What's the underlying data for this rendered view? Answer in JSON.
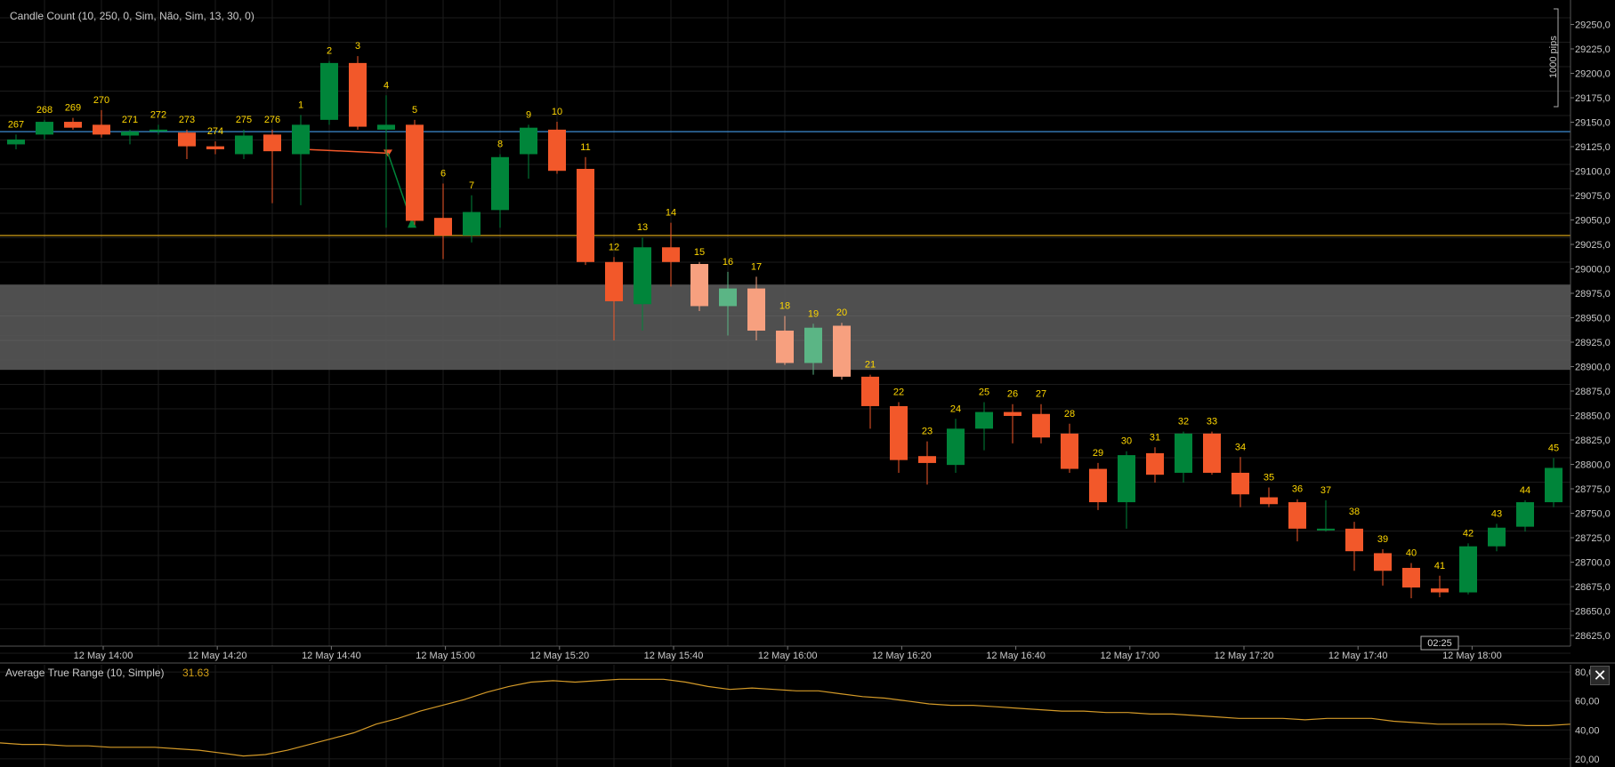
{
  "indicator_label": "Candle Count (10, 250, 0, Sim, Não, Sim, 13, 30, 0)",
  "atr_label": "Average True Range (10, Simple)",
  "atr_value": "31.63",
  "scale_note": "1000 pips",
  "timer": "02:25",
  "close_icon": "close-icon",
  "colors": {
    "background": "#000000",
    "bull": "#00853a",
    "bear": "#f2582a",
    "bull_light": "#5bb585",
    "bear_light": "#f7a07f",
    "count_label": "#ffd700",
    "blue_line": "#3d8bd0",
    "gold_line": "#d4a017",
    "atr_line": "#d49a28",
    "zone": "#585858"
  },
  "chart_data": {
    "type": "candlestick",
    "y_range": [
      28615,
      29265
    ],
    "y_ticks": [
      "29250,0",
      "29225,0",
      "29200,0",
      "29175,0",
      "29150,0",
      "29125,0",
      "29100,0",
      "29075,0",
      "29050,0",
      "29025,0",
      "29000,0",
      "28975,0",
      "28950,0",
      "28925,0",
      "28900,0",
      "28875,0",
      "28850,0",
      "28825,0",
      "28800,0",
      "28775,0",
      "28750,0",
      "28725,0",
      "28700,0",
      "28675,0",
      "28650,0",
      "28625,0"
    ],
    "x_ticks": [
      "12 May 14:00",
      "12 May 14:20",
      "12 May 14:40",
      "12 May 15:00",
      "12 May 15:20",
      "12 May 15:40",
      "12 May 16:00",
      "12 May 16:20",
      "12 May 16:40",
      "12 May 17:00",
      "12 May 17:20",
      "12 May 17:40",
      "12 May 18:00"
    ],
    "candles": [
      {
        "label": "267",
        "o": 29125,
        "h": 29135,
        "l": 29120,
        "c": 29130
      },
      {
        "label": "268",
        "o": 29135,
        "h": 29150,
        "l": 29130,
        "c": 29148
      },
      {
        "label": "269",
        "o": 29148,
        "h": 29152,
        "l": 29140,
        "c": 29142
      },
      {
        "label": "270",
        "o": 29145,
        "h": 29160,
        "l": 29132,
        "c": 29135
      },
      {
        "label": "271",
        "o": 29134,
        "h": 29140,
        "l": 29125,
        "c": 29138
      },
      {
        "label": "272",
        "o": 29140,
        "h": 29145,
        "l": 29135,
        "c": 29140
      },
      {
        "label": "273",
        "o": 29137,
        "h": 29140,
        "l": 29110,
        "c": 29123
      },
      {
        "label": "274",
        "o": 29123,
        "h": 29128,
        "l": 29115,
        "c": 29120
      },
      {
        "label": "275",
        "o": 29115,
        "h": 29140,
        "l": 29110,
        "c": 29134
      },
      {
        "label": "276",
        "o": 29135,
        "h": 29140,
        "l": 29065,
        "c": 29118
      },
      {
        "label": "1",
        "o": 29115,
        "h": 29155,
        "l": 29063,
        "c": 29145
      },
      {
        "label": "2",
        "o": 29150,
        "h": 29210,
        "l": 29145,
        "c": 29208
      },
      {
        "label": "3",
        "o": 29208,
        "h": 29215,
        "l": 29140,
        "c": 29143
      },
      {
        "label": "4",
        "o": 29140,
        "h": 29175,
        "l": 29040,
        "c": 29145
      },
      {
        "label": "5",
        "o": 29145,
        "h": 29150,
        "l": 29043,
        "c": 29047
      },
      {
        "label": "6",
        "o": 29050,
        "h": 29085,
        "l": 29008,
        "c": 29032
      },
      {
        "label": "7",
        "o": 29032,
        "h": 29073,
        "l": 29025,
        "c": 29056
      },
      {
        "label": "8",
        "o": 29058,
        "h": 29115,
        "l": 29040,
        "c": 29112
      },
      {
        "label": "9",
        "o": 29115,
        "h": 29145,
        "l": 29090,
        "c": 29142
      },
      {
        "label": "10",
        "o": 29140,
        "h": 29148,
        "l": 29095,
        "c": 29098
      },
      {
        "label": "11",
        "o": 29100,
        "h": 29112,
        "l": 29002,
        "c": 29005
      },
      {
        "label": "12",
        "o": 29005,
        "h": 29010,
        "l": 28925,
        "c": 28965
      },
      {
        "label": "13",
        "o": 28962,
        "h": 29030,
        "l": 28935,
        "c": 29020
      },
      {
        "label": "14",
        "o": 29020,
        "h": 29045,
        "l": 28980,
        "c": 29005
      },
      {
        "label": "15",
        "o": 29003,
        "h": 29005,
        "l": 28955,
        "c": 28960
      },
      {
        "label": "16",
        "o": 28960,
        "h": 28995,
        "l": 28930,
        "c": 28978
      },
      {
        "label": "17",
        "o": 28978,
        "h": 28990,
        "l": 28925,
        "c": 28935
      },
      {
        "label": "18",
        "o": 28935,
        "h": 28950,
        "l": 28900,
        "c": 28902
      },
      {
        "label": "19",
        "o": 28902,
        "h": 28942,
        "l": 28890,
        "c": 28938
      },
      {
        "label": "20",
        "o": 28940,
        "h": 28943,
        "l": 28885,
        "c": 28888
      },
      {
        "label": "21",
        "o": 28888,
        "h": 28890,
        "l": 28835,
        "c": 28858
      },
      {
        "label": "22",
        "o": 28858,
        "h": 28862,
        "l": 28790,
        "c": 28803
      },
      {
        "label": "23",
        "o": 28807,
        "h": 28822,
        "l": 28778,
        "c": 28800
      },
      {
        "label": "24",
        "o": 28798,
        "h": 28845,
        "l": 28790,
        "c": 28835
      },
      {
        "label": "25",
        "o": 28835,
        "h": 28862,
        "l": 28813,
        "c": 28852
      },
      {
        "label": "26",
        "o": 28852,
        "h": 28860,
        "l": 28820,
        "c": 28848
      },
      {
        "label": "27",
        "o": 28850,
        "h": 28860,
        "l": 28820,
        "c": 28826
      },
      {
        "label": "28",
        "o": 28830,
        "h": 28840,
        "l": 28790,
        "c": 28794
      },
      {
        "label": "29",
        "o": 28794,
        "h": 28800,
        "l": 28752,
        "c": 28760
      },
      {
        "label": "30",
        "o": 28760,
        "h": 28812,
        "l": 28733,
        "c": 28808
      },
      {
        "label": "31",
        "o": 28810,
        "h": 28816,
        "l": 28780,
        "c": 28788
      },
      {
        "label": "32",
        "o": 28790,
        "h": 28832,
        "l": 28780,
        "c": 28830
      },
      {
        "label": "33",
        "o": 28830,
        "h": 28832,
        "l": 28788,
        "c": 28790
      },
      {
        "label": "34",
        "o": 28790,
        "h": 28806,
        "l": 28755,
        "c": 28768
      },
      {
        "label": "35",
        "o": 28765,
        "h": 28775,
        "l": 28755,
        "c": 28758
      },
      {
        "label": "36",
        "o": 28760,
        "h": 28763,
        "l": 28720,
        "c": 28733
      },
      {
        "label": "37",
        "o": 28733,
        "h": 28762,
        "l": 28730,
        "c": 28733
      },
      {
        "label": "38",
        "o": 28733,
        "h": 28740,
        "l": 28690,
        "c": 28710
      },
      {
        "label": "39",
        "o": 28708,
        "h": 28712,
        "l": 28675,
        "c": 28690
      },
      {
        "label": "40",
        "o": 28693,
        "h": 28698,
        "l": 28662,
        "c": 28673
      },
      {
        "label": "41",
        "o": 28672,
        "h": 28685,
        "l": 28663,
        "c": 28668
      },
      {
        "label": "42",
        "o": 28668,
        "h": 28718,
        "l": 28666,
        "c": 28715
      },
      {
        "label": "43",
        "o": 28715,
        "h": 28738,
        "l": 28710,
        "c": 28734
      },
      {
        "label": "44",
        "o": 28735,
        "h": 28762,
        "l": 28730,
        "c": 28760
      },
      {
        "label": "45",
        "o": 28760,
        "h": 28805,
        "l": 28755,
        "c": 28795
      }
    ],
    "blue_line": 29138,
    "gold_line": 29032,
    "zone": [
      28895,
      28982
    ],
    "atr": {
      "y_range": [
        15,
        85
      ],
      "y_ticks": [
        "80,00",
        "60,00",
        "40,00",
        "20,00"
      ],
      "values": [
        31,
        30,
        30,
        29,
        29,
        28,
        28,
        28,
        27,
        26,
        24,
        22,
        23,
        26,
        30,
        34,
        38,
        44,
        48,
        53,
        57,
        61,
        66,
        70,
        73,
        74,
        73,
        74,
        75,
        75,
        75,
        73,
        70,
        68,
        69,
        68,
        67,
        67,
        65,
        63,
        62,
        60,
        58,
        57,
        57,
        56,
        55,
        54,
        53,
        53,
        52,
        52,
        51,
        51,
        50,
        49,
        48,
        48,
        48,
        47,
        48,
        48,
        48,
        46,
        45,
        44,
        44,
        44,
        44,
        43,
        43,
        44
      ]
    }
  }
}
